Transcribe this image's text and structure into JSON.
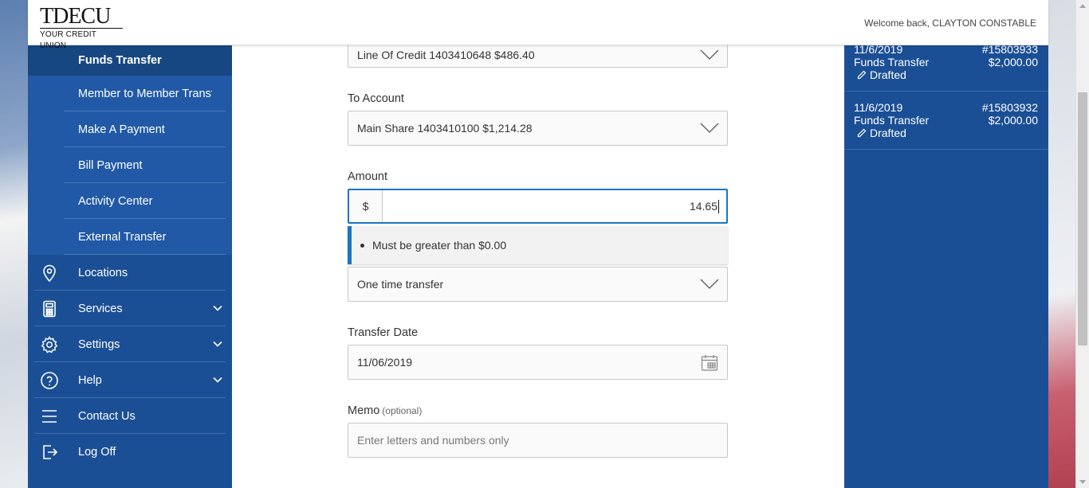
{
  "header": {
    "logo_main": "TDECU",
    "logo_sub": "YOUR CREDIT UNION",
    "welcome": "Welcome back, CLAYTON CONSTABLE"
  },
  "sidebar": {
    "sub_items": [
      {
        "label": "Funds Transfer",
        "active": true
      },
      {
        "label": "Member to Member Transfer"
      },
      {
        "label": "Make A Payment"
      },
      {
        "label": "Bill Payment"
      },
      {
        "label": "Activity Center"
      },
      {
        "label": "External Transfer"
      }
    ],
    "main_items": [
      {
        "label": "Locations",
        "icon": "location-pin-icon"
      },
      {
        "label": "Services",
        "icon": "calculator-icon",
        "expandable": true
      },
      {
        "label": "Settings",
        "icon": "gear-icon",
        "expandable": true
      },
      {
        "label": "Help",
        "icon": "help-circle-icon",
        "expandable": true
      },
      {
        "label": "Contact Us",
        "icon": "menu-lines-icon"
      },
      {
        "label": "Log Off",
        "icon": "logout-icon"
      }
    ]
  },
  "form": {
    "from_account_value": "Line Of Credit 1403410648 $486.40",
    "to_account_label": "To Account",
    "to_account_value": "Main Share 1403410100 $1,214.28",
    "amount_label": "Amount",
    "currency_symbol": "$",
    "amount_value": "14.65",
    "amount_error": "Must be greater than $0.00",
    "frequency_value": "One time transfer",
    "transfer_date_label": "Transfer Date",
    "transfer_date_value": "11/06/2019",
    "memo_label": "Memo",
    "memo_optional": "(optional)",
    "memo_placeholder": "Enter letters and numbers only"
  },
  "transactions": [
    {
      "date": "11/6/2019",
      "number": "#15803933",
      "type": "Funds Transfer",
      "amount": "$2,000.00",
      "status": "Drafted"
    },
    {
      "date": "11/6/2019",
      "number": "#15803932",
      "type": "Funds Transfer",
      "amount": "$2,000.00",
      "status": "Drafted"
    }
  ],
  "colors": {
    "sidebar_bg": "#1b4f95",
    "sub_item_bg": "#2159a6",
    "accent_blue": "#1a76c2"
  }
}
